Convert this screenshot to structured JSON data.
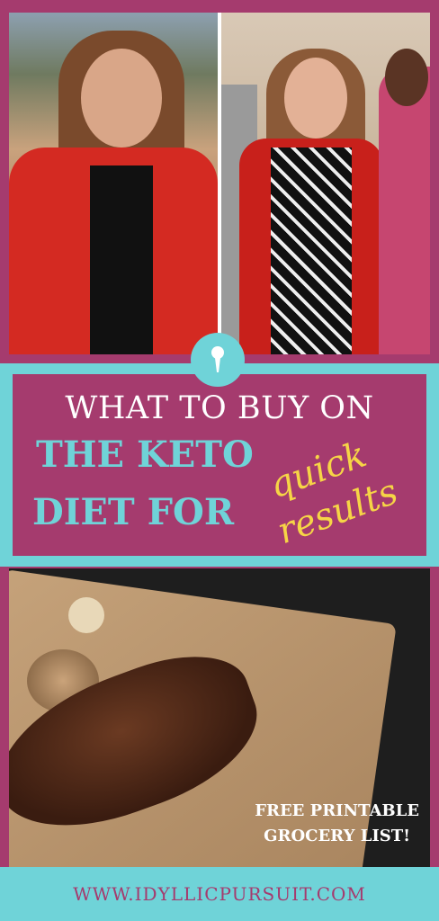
{
  "colors": {
    "magenta": "#a53b6e",
    "teal": "#6fd3d8",
    "yellow": "#f6d546",
    "white": "#ffffff"
  },
  "hero_photos": {
    "left": "before-photo",
    "right": "after-photo"
  },
  "logo_icon": "pin-icon",
  "title": {
    "line1": "WHAT TO BUY ON",
    "line2": "THE KETO",
    "line3": "DIET FOR",
    "script_word1": "quick",
    "script_word2": "results"
  },
  "food_photo": "steak-photo",
  "caption": {
    "line1": "FREE PRINTABLE",
    "line2": "GROCERY LIST!"
  },
  "footer": {
    "url": "WWW.IDYLLICPURSUIT.COM"
  }
}
